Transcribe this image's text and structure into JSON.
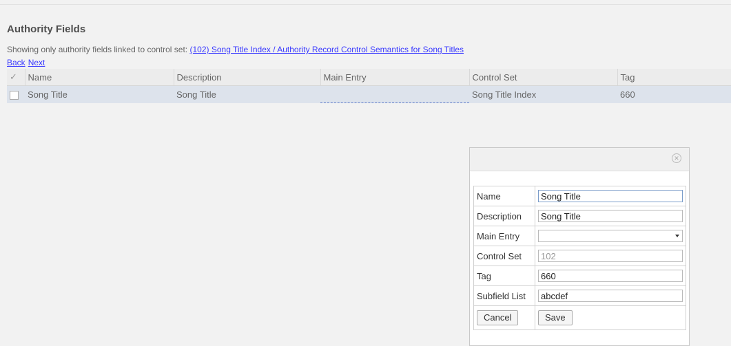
{
  "page": {
    "title": "Authority Fields",
    "filter_text": "Showing only authority fields linked to control set:",
    "filter_link": "(102) Song Title Index / Authority Record Control Semantics for Song Titles",
    "back": "Back",
    "next": "Next"
  },
  "grid": {
    "check_header": "✓",
    "columns": [
      "Name",
      "Description",
      "Main Entry",
      "Control Set",
      "Tag"
    ],
    "rows": [
      {
        "name": "Song Title",
        "description": "Song Title",
        "main_entry": "",
        "control_set": "Song Title Index",
        "tag": "660"
      }
    ]
  },
  "dialog": {
    "close_icon": "close-icon",
    "fields": {
      "name": {
        "label": "Name",
        "value": "Song Title"
      },
      "description": {
        "label": "Description",
        "value": "Song Title"
      },
      "main_entry": {
        "label": "Main Entry",
        "value": ""
      },
      "control_set": {
        "label": "Control Set",
        "value": "102"
      },
      "tag": {
        "label": "Tag",
        "value": "660"
      },
      "subfield_list": {
        "label": "Subfield List",
        "value": "abcdef"
      }
    },
    "cancel": "Cancel",
    "save": "Save"
  }
}
